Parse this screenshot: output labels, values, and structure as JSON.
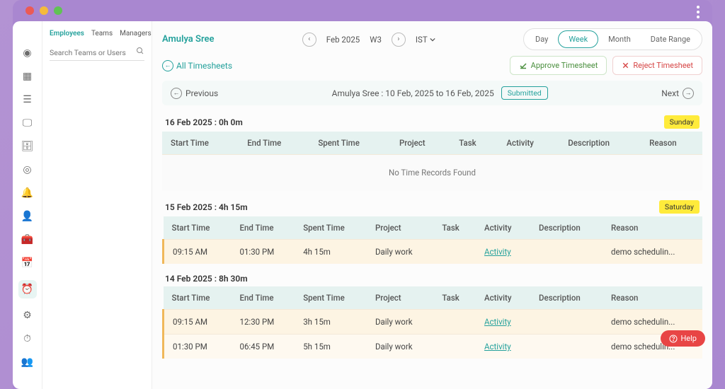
{
  "sidebar": {
    "tabs": [
      "Employees",
      "Teams",
      "Managers"
    ],
    "active_tab": 0,
    "search_placeholder": "Search Teams or Users"
  },
  "icon_rail": [
    {
      "name": "dashboard-icon",
      "glyph": "◉"
    },
    {
      "name": "grid-icon",
      "glyph": "▦"
    },
    {
      "name": "stack-icon",
      "glyph": "☰"
    },
    {
      "name": "monitor-icon",
      "glyph": "🖵"
    },
    {
      "name": "briefcase-icon",
      "glyph": "🗄"
    },
    {
      "name": "target-icon",
      "glyph": "◎"
    },
    {
      "name": "bell-icon",
      "glyph": "🔔"
    },
    {
      "name": "user-icon",
      "glyph": "👤"
    },
    {
      "name": "toolbox-icon",
      "glyph": "🧰"
    },
    {
      "name": "calendar-icon",
      "glyph": "📅"
    },
    {
      "name": "clock-icon",
      "glyph": "⏰",
      "active": true
    },
    {
      "name": "gauge-icon",
      "glyph": "⚙"
    },
    {
      "name": "stopwatch-icon",
      "glyph": "⏱"
    },
    {
      "name": "people-icon",
      "glyph": "👥"
    }
  ],
  "header": {
    "employee_name": "Amulya Sree",
    "period_label": "Feb 2025",
    "week_label": "W3",
    "timezone": "IST",
    "views": [
      "Day",
      "Week",
      "Month",
      "Date Range"
    ],
    "active_view": 1
  },
  "subheader": {
    "back_label": "All Timesheets",
    "approve_label": "Approve Timesheet",
    "reject_label": "Reject Timesheet"
  },
  "navbar": {
    "prev_label": "Previous",
    "next_label": "Next",
    "range_text": "Amulya Sree : 10 Feb, 2025 to 16 Feb, 2025",
    "status": "Submitted"
  },
  "columns": [
    "Start Time",
    "End Time",
    "Spent Time",
    "Project",
    "Task",
    "Activity",
    "Description",
    "Reason"
  ],
  "days": [
    {
      "title": "16 Feb 2025 : 0h 0m",
      "badge": "Sunday",
      "rows": [],
      "empty_text": "No Time Records Found"
    },
    {
      "title": "15 Feb 2025 : 4h 15m",
      "badge": "Saturday",
      "rows": [
        {
          "start": "09:15 AM",
          "end": "01:30 PM",
          "spent": "4h 15m",
          "project": "Daily work",
          "task": "",
          "activity": "Activity",
          "desc": "",
          "reason": "demo schedulin..."
        }
      ]
    },
    {
      "title": "14 Feb 2025 : 8h 30m",
      "badge": "",
      "rows": [
        {
          "start": "09:15 AM",
          "end": "12:30 PM",
          "spent": "3h 15m",
          "project": "Daily work",
          "task": "",
          "activity": "Activity",
          "desc": "",
          "reason": "demo schedulin..."
        },
        {
          "start": "01:30 PM",
          "end": "06:45 PM",
          "spent": "5h 15m",
          "project": "Daily work",
          "task": "",
          "activity": "Activity",
          "desc": "",
          "reason": "demo schedulin..."
        }
      ]
    }
  ],
  "help_label": "Help"
}
